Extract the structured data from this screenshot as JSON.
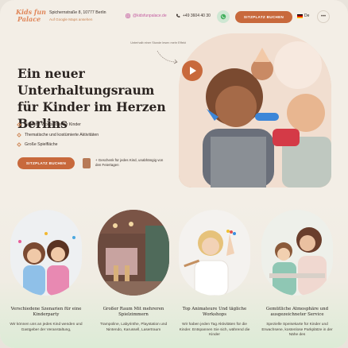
{
  "header": {
    "logo_line1": "Kids fun",
    "logo_line2": "Palace",
    "address": "Spichernstraße 8, 10777 Berlin",
    "map_link": "Auf Google Maps ansehen",
    "instagram": "@kidsfunpalace.de",
    "phone": "+49 3604 40 30",
    "book_button": "Sitzplatz buchen",
    "language": "De",
    "more_label": "•••"
  },
  "hero": {
    "title": "Ein neuer Unterhaltungsraum für Kinder im Herzen Berlins",
    "note": "Unterhalb einer Stunde lesen mehr Effekt",
    "features": [
      "Tägliche Workshops für Kinder",
      "Thematische und kostümierte Aktivitäten",
      "Große Spielfläche"
    ],
    "book_button": "Sitzplatz buchen",
    "gift_text": "+ Geschenk für jedes Kind, unabhängig von den Feiertagen"
  },
  "cards": [
    {
      "title": "Verschiedene Szenarien für eine Kinderparty",
      "text": "Wir können uns an jedes Kind wenden und Gastgeber der Veranstaltung,"
    },
    {
      "title": "Großer Raum Mit mehreren Spielzimmern",
      "text": "Trampoline, Labyrinthe, Playstation und Nintendo, Karussell, Lasertraum"
    },
    {
      "title": "Top Animateure Und tägliche Workshops",
      "text": "Wir haben jeden Tag Aktivitäten für die Kinder. Entspannen Sie sich, während die Kinder"
    },
    {
      "title": "Gemütliche Atmosphäre und ausgezeichneter Service",
      "text": "Spezielle Speisekarte für Kinder und Erwachsene, kostenlose Parkplätze in der Nähe des"
    }
  ],
  "colors": {
    "accent": "#c8693c",
    "background": "#f3eee6",
    "green_fade": "#dcebd6"
  },
  "icons": [
    "instagram-icon",
    "phone-icon",
    "whatsapp-icon",
    "german-flag-icon",
    "play-icon",
    "gift-icon",
    "diamond-bullet-icon"
  ]
}
